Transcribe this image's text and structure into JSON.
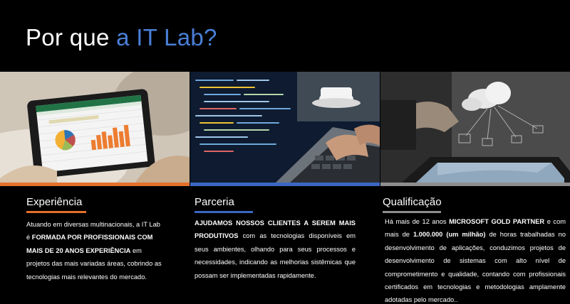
{
  "header": {
    "title_prefix": "Por que ",
    "title_accent": "a IT Lab?"
  },
  "colors": {
    "accent_blue": "#4a7fd8",
    "bar_orange": "#e4702b",
    "bar_blue": "#3b67c4",
    "bar_gray": "#8e8e8e"
  },
  "sections": [
    {
      "heading": "Experiência",
      "text": {
        "p1": "Atuando em diversas multinacionais, a IT Lab é ",
        "b1": "FORMADA POR PROFISSIONAIS COM MAIS DE 20 ANOS EXPERIÊNCIA",
        "p2": " em projetos das mais variadas áreas, cobrindo as tecnologias mais relevantes do mercado."
      }
    },
    {
      "heading": "Parceria",
      "text": {
        "b1": "AJUDAMOS NOSSOS CLIENTES A SEREM MAIS PRODUTIVOS",
        "p1": " com as tecnologias disponíveis em seus ambientes, olhando para seus processos e necessidades, indicando as melhorias sistêmicas que possam ser implementadas rapidamente."
      }
    },
    {
      "heading": "Qualificação",
      "text": {
        "p1": "Há mais de 12 anos ",
        "b1": "MICROSOFT GOLD PARTNER",
        "p2": " e com mais de ",
        "b2": "1.000.000 (um milhão)",
        "p3": " de horas trabalhadas no desenvolvimento de aplicações, conduzimos projetos de desenvolvimento de sistemas com alto nível de comprometimento e qualidade, contando com profissionais certificados em tecnologias e metodologias amplamente adotadas pelo mercado.."
      }
    }
  ]
}
